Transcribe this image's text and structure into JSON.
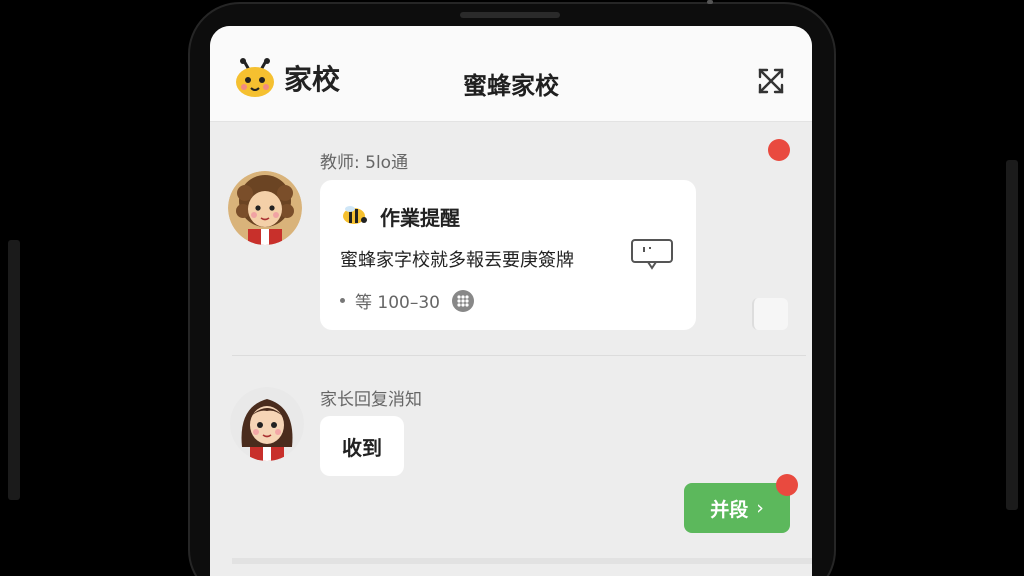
{
  "header": {
    "brand": "家校",
    "title": "蜜蜂家校"
  },
  "notice": {
    "sender": "教师: 5lo通",
    "title": "作業提醒",
    "body": "蜜蜂家字校就多報丟要庚簽牌",
    "meta": "等 100–30"
  },
  "reply": {
    "sender": "家长回复消知",
    "text": "收到"
  },
  "action": {
    "label": "并段",
    "chevron": "›"
  },
  "icons": {
    "logo": "bee-icon",
    "expand": "expand-arrows-icon",
    "card_title": "bee-icon",
    "screen": "screen-feedback-icon",
    "meta": "grid-dots-icon"
  },
  "colors": {
    "notification": "#e94a3f",
    "action": "#5cb85c",
    "brand_yellow": "#f5c030"
  }
}
